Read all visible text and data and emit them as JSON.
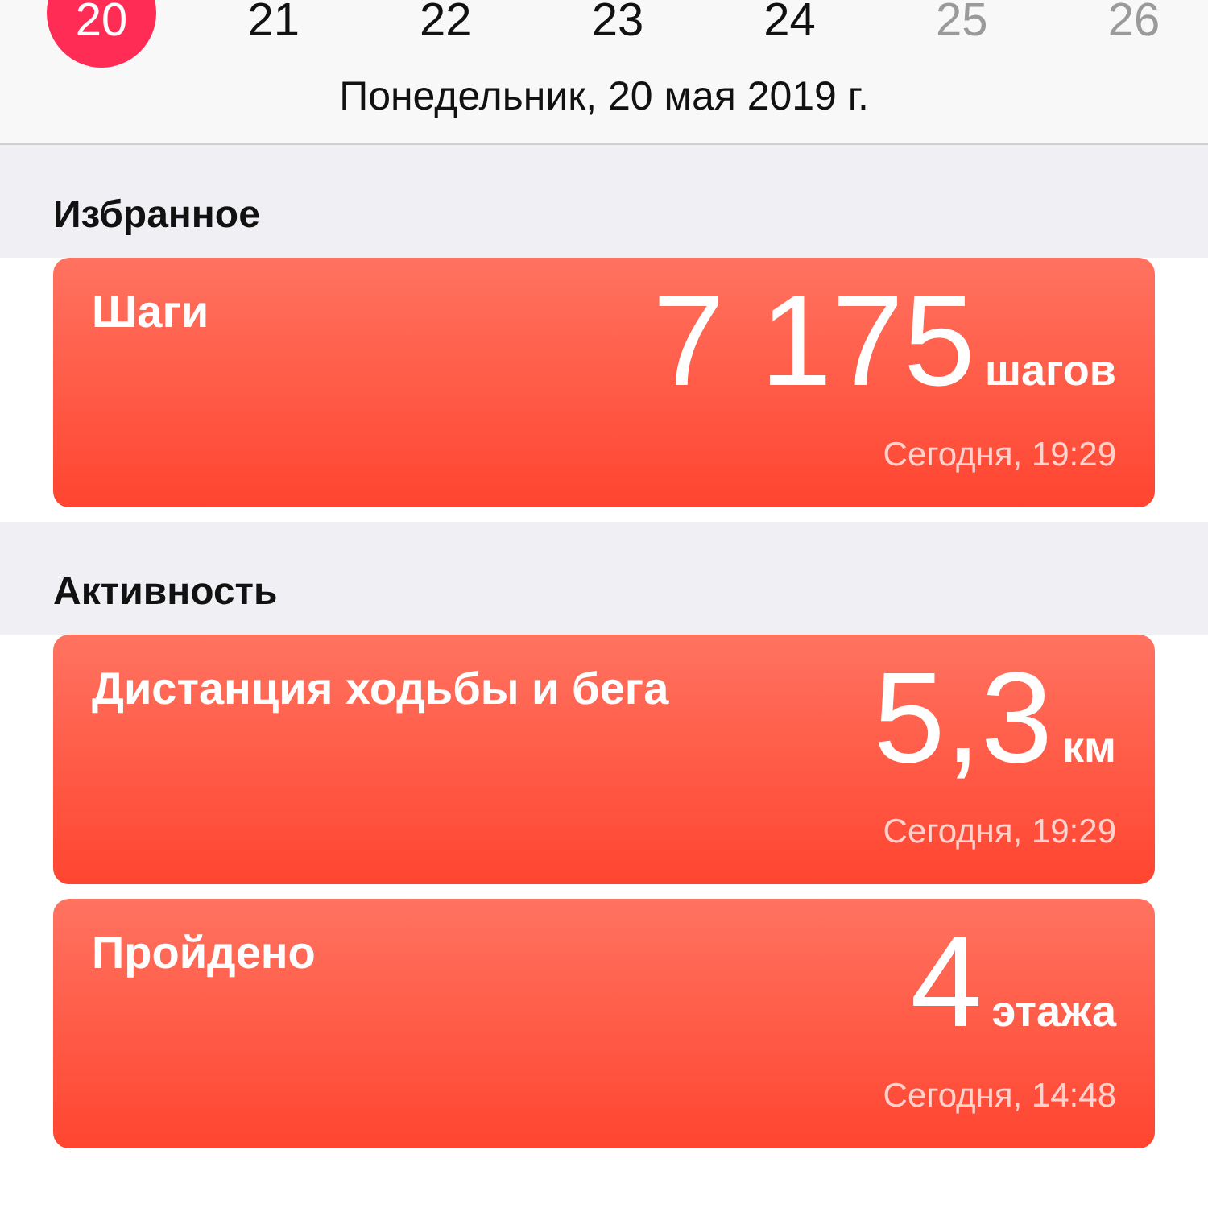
{
  "days": [
    {
      "label": "20",
      "selected": true,
      "dimmed": false
    },
    {
      "label": "21",
      "selected": false,
      "dimmed": false
    },
    {
      "label": "22",
      "selected": false,
      "dimmed": false
    },
    {
      "label": "23",
      "selected": false,
      "dimmed": false
    },
    {
      "label": "24",
      "selected": false,
      "dimmed": false
    },
    {
      "label": "25",
      "selected": false,
      "dimmed": true
    },
    {
      "label": "26",
      "selected": false,
      "dimmed": true
    }
  ],
  "date": "Понедельник, 20 мая 2019 г.",
  "sections": [
    {
      "title": "Избранное",
      "cards": [
        {
          "title": "Шаги",
          "value": "7 175",
          "unit": "шагов",
          "time": "Сегодня, 19:29"
        }
      ]
    },
    {
      "title": "Активность",
      "cards": [
        {
          "title": "Дистанция ходьбы и бега",
          "value": "5,3",
          "unit": "км",
          "time": "Сегодня, 19:29"
        },
        {
          "title": "Пройдено",
          "value": "4",
          "unit": "этажа",
          "time": "Сегодня, 14:48"
        }
      ]
    }
  ]
}
